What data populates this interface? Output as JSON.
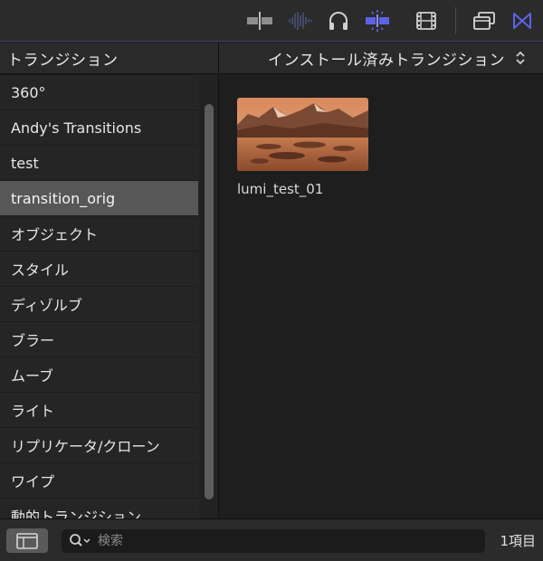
{
  "toolbar": {
    "icons": [
      "trim-icon",
      "audio-waveform-icon",
      "headphones-icon",
      "snapping-icon",
      "filmstrip-icon",
      "window-arrange-icon",
      "transitions-icon"
    ],
    "accent_color": "#5b63e6"
  },
  "header": {
    "sidebar_title": "トランジション",
    "content_title": "インストール済みトランジション"
  },
  "sidebar": {
    "selected_index": 3,
    "items": [
      {
        "label": "360°"
      },
      {
        "label": "Andy's Transitions"
      },
      {
        "label": "test"
      },
      {
        "label": "transition_orig"
      },
      {
        "label": "オブジェクト"
      },
      {
        "label": "スタイル"
      },
      {
        "label": "ディゾルブ"
      },
      {
        "label": "ブラー"
      },
      {
        "label": "ムーブ"
      },
      {
        "label": "ライト"
      },
      {
        "label": "リプリケータ/クローン"
      },
      {
        "label": "ワイプ"
      },
      {
        "label": "動的トランジション"
      }
    ]
  },
  "content": {
    "items": [
      {
        "label": "lumi_test_01",
        "thumbnail": "mountain-lake-thumbnail"
      }
    ]
  },
  "bottombar": {
    "search_placeholder": "検索",
    "item_count": "1項目"
  }
}
